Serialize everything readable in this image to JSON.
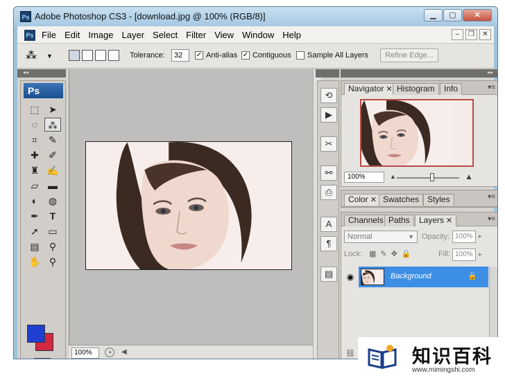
{
  "window": {
    "title": "Adobe Photoshop CS3 - [download.jpg @ 100% (RGB/8)]",
    "app_icon": "Ps",
    "controls": {
      "minimize": "▁",
      "maximize": "▢",
      "close": "✕"
    }
  },
  "menubar": {
    "doc_icon": "Ps",
    "items": [
      "File",
      "Edit",
      "Image",
      "Layer",
      "Select",
      "Filter",
      "View",
      "Window",
      "Help"
    ],
    "doc_controls": {
      "minimize": "–",
      "restore": "❐",
      "close": "✕"
    }
  },
  "options": {
    "tool_icon": "magic-wand-icon",
    "tolerance_label": "Tolerance:",
    "tolerance_value": "32",
    "anti_alias_label": "Anti-alias",
    "anti_alias_checked": true,
    "contiguous_label": "Contiguous",
    "contiguous_checked": true,
    "sample_all_label": "Sample All Layers",
    "sample_all_checked": false,
    "refine_edge_label": "Refine Edge..."
  },
  "toolbox": {
    "logo": "Ps",
    "foreground_color": "#1f3fd0",
    "background_color": "#d32742"
  },
  "document": {
    "zoom": "100%"
  },
  "navigator_panel": {
    "tabs": [
      "Navigator",
      "Histogram",
      "Info"
    ],
    "zoom": "100%"
  },
  "color_panel": {
    "tabs": [
      "Color",
      "Swatches",
      "Styles"
    ]
  },
  "layers_panel": {
    "tabs": [
      "Channels",
      "Paths",
      "Layers"
    ],
    "blend_mode": "Normal",
    "opacity_label": "Opacity:",
    "opacity_value": "100%",
    "lock_label": "Lock:",
    "fill_label": "Fill:",
    "fill_value": "100%",
    "layer_name": "Background",
    "selection_color": "#3d8fe6"
  },
  "watermark": {
    "title": "知识百科",
    "url": "www.mimingshi.com"
  }
}
